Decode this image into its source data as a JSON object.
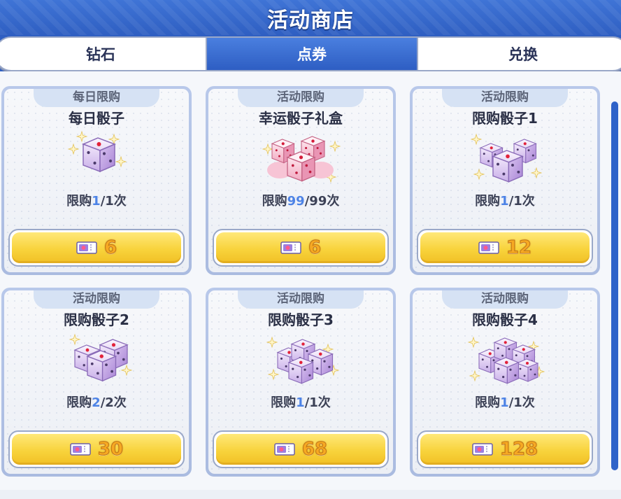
{
  "header": {
    "title": "活动商店"
  },
  "tabs": [
    {
      "label": "钻石",
      "active": false
    },
    {
      "label": "点券",
      "active": true
    },
    {
      "label": "兑换",
      "active": false
    }
  ],
  "currency_icon": "ticket-icon",
  "items": [
    {
      "tag": "每日限购",
      "name": "每日骰子",
      "limit_prefix": "限购",
      "current": "1",
      "total": "/1次",
      "price": "6",
      "art": "single-die"
    },
    {
      "tag": "活动限购",
      "name": "幸运骰子礼盒",
      "limit_prefix": "限购",
      "current": "99",
      "total": "/99次",
      "price": "6",
      "art": "pink-dice-box"
    },
    {
      "tag": "活动限购",
      "name": "限购骰子1",
      "limit_prefix": "限购",
      "current": "1",
      "total": "/1次",
      "price": "12",
      "art": "three-dice"
    },
    {
      "tag": "活动限购",
      "name": "限购骰子2",
      "limit_prefix": "限购",
      "current": "2",
      "total": "/2次",
      "price": "30",
      "art": "two-dice"
    },
    {
      "tag": "活动限购",
      "name": "限购骰子3",
      "limit_prefix": "限购",
      "current": "1",
      "total": "/1次",
      "price": "68",
      "art": "dice-pile"
    },
    {
      "tag": "活动限购",
      "name": "限购骰子4",
      "limit_prefix": "限购",
      "current": "1",
      "total": "/1次",
      "price": "128",
      "art": "dice-pile-large"
    }
  ],
  "colors": {
    "header": "#3f74d6",
    "button": "#f8d33c",
    "price": "#f6a923",
    "limit_highlight": "#4d83e6"
  }
}
